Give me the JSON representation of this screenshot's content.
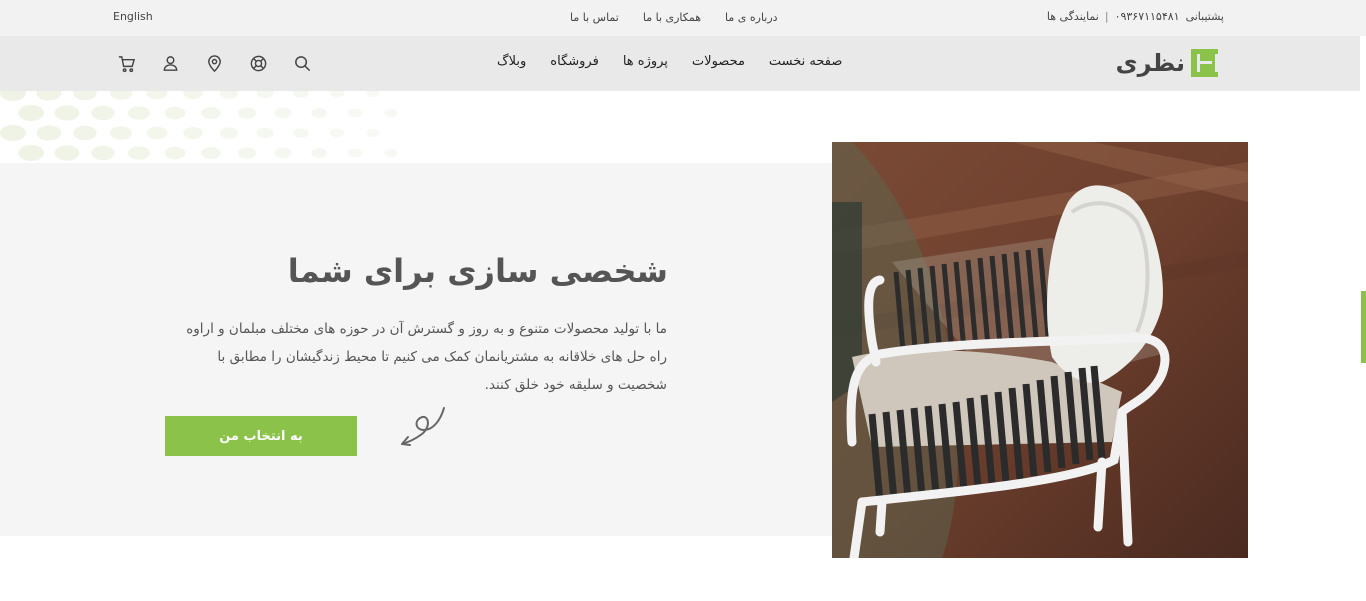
{
  "topbar": {
    "language": "English",
    "links": [
      "درباره ی ما",
      "همکاری با ما",
      "تماس با ما"
    ],
    "support_label": "پشتیبانی",
    "support_phone": "۰۹۳۶۷۱۱۵۴۸۱",
    "separator": "|",
    "agencies": "نمایندگی ها"
  },
  "logo": {
    "text": "نظری",
    "brand_color": "#8bc34a"
  },
  "nav": {
    "items": [
      "صفحه نخست",
      "محصولات",
      "پروژه ها",
      "فروشگاه",
      "وبلاگ"
    ],
    "icons": [
      "search-icon",
      "support-icon",
      "location-icon",
      "user-icon",
      "cart-icon"
    ]
  },
  "hero": {
    "title": "شخصی سازی برای شما",
    "description": "ما با تولید محصولات متنوع و به روز و گسترش آن در حوزه های مختلف مبلمان و اراوه راه حل های خلاقانه به مشتریانمان کمک می کنیم تا محیط زندگیشان را مطابق با شخصیت و سلیقه خود خلق کنند.",
    "button_label": "به انتخاب من",
    "accent": "#8bc34a"
  }
}
